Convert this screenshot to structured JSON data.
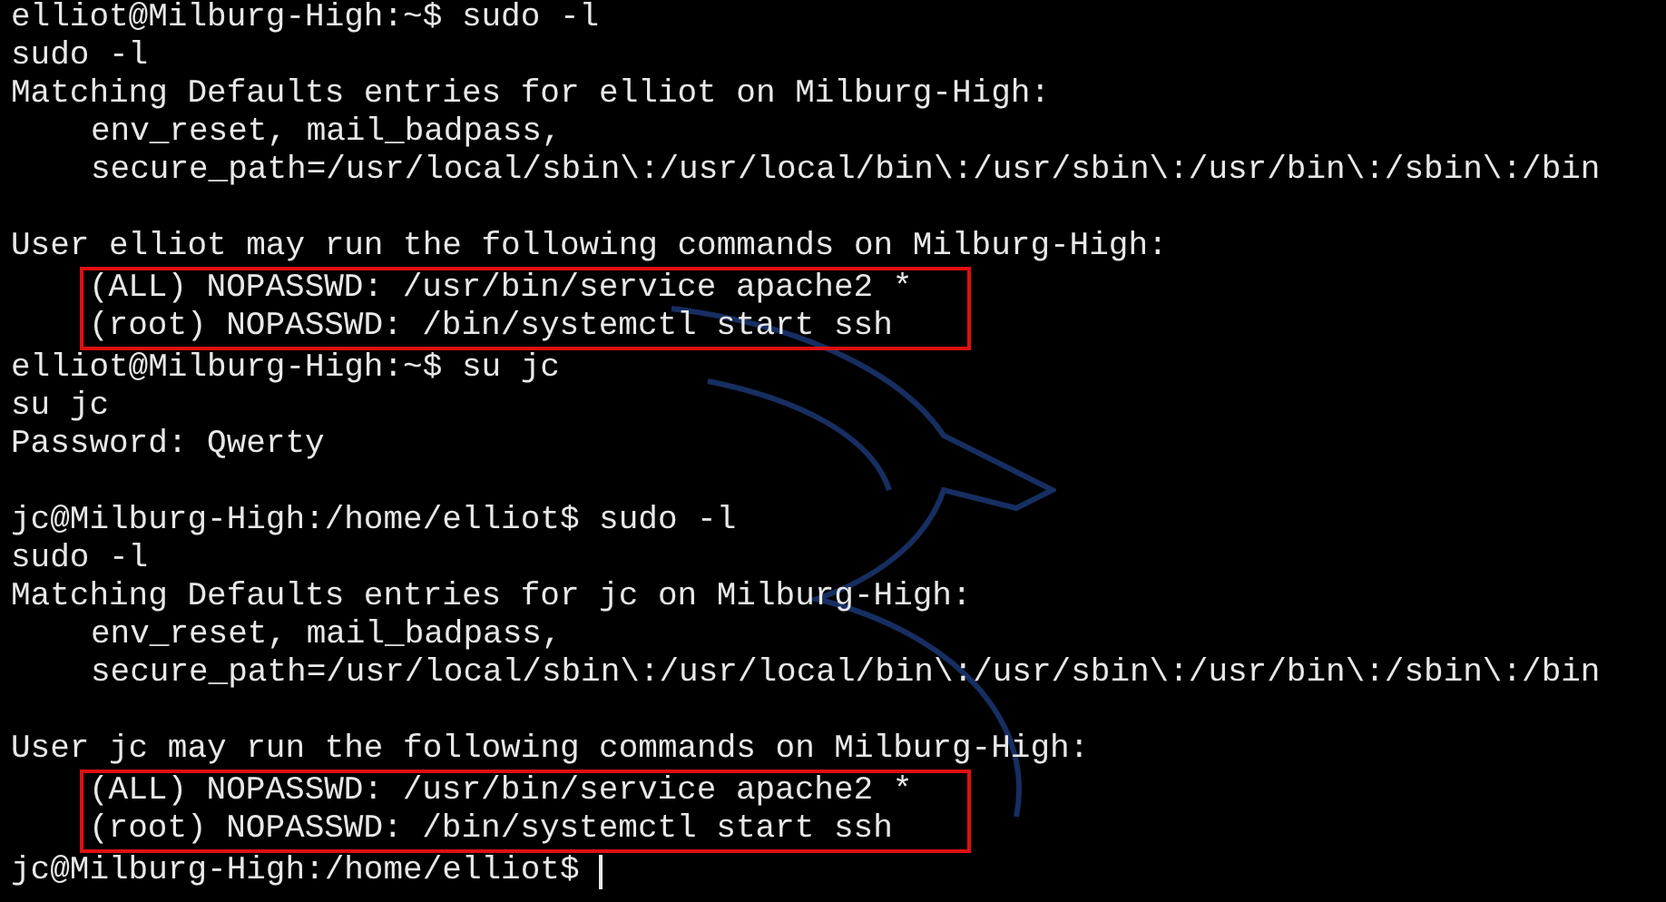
{
  "terminal": {
    "blocks": [
      {
        "kind": "line",
        "text": "elliot@Milburg-High:~$ sudo -l"
      },
      {
        "kind": "line",
        "text": "sudo -l"
      },
      {
        "kind": "line",
        "text": "Matching Defaults entries for elliot on Milburg-High:"
      },
      {
        "kind": "line",
        "indent": true,
        "text": "env_reset, mail_badpass,"
      },
      {
        "kind": "line",
        "indent": true,
        "text": "secure_path=/usr/local/sbin\\:/usr/local/bin\\:/usr/sbin\\:/usr/bin\\:/sbin\\:/bin"
      },
      {
        "kind": "blank"
      },
      {
        "kind": "line",
        "text": "User elliot may run the following commands on Milburg-High:"
      },
      {
        "kind": "highlight",
        "lines": [
          "(ALL) NOPASSWD: /usr/bin/service apache2 *",
          "(root) NOPASSWD: /bin/systemctl start ssh"
        ]
      },
      {
        "kind": "line",
        "text": "elliot@Milburg-High:~$ su jc"
      },
      {
        "kind": "line",
        "text": "su jc"
      },
      {
        "kind": "line",
        "text": "Password: Qwerty"
      },
      {
        "kind": "blank"
      },
      {
        "kind": "line",
        "text": "jc@Milburg-High:/home/elliot$ sudo -l"
      },
      {
        "kind": "line",
        "text": "sudo -l"
      },
      {
        "kind": "line",
        "text": "Matching Defaults entries for jc on Milburg-High:"
      },
      {
        "kind": "line",
        "indent": true,
        "text": "env_reset, mail_badpass,"
      },
      {
        "kind": "line",
        "indent": true,
        "text": "secure_path=/usr/local/sbin\\:/usr/local/bin\\:/usr/sbin\\:/usr/bin\\:/sbin\\:/bin"
      },
      {
        "kind": "blank"
      },
      {
        "kind": "line",
        "text": "User jc may run the following commands on Milburg-High:"
      },
      {
        "kind": "highlight",
        "lines": [
          "(ALL) NOPASSWD: /usr/bin/service apache2 *",
          "(root) NOPASSWD: /bin/systemctl start ssh"
        ]
      },
      {
        "kind": "line",
        "text": "jc@Milburg-High:/home/elliot$",
        "cursor": true
      }
    ]
  }
}
